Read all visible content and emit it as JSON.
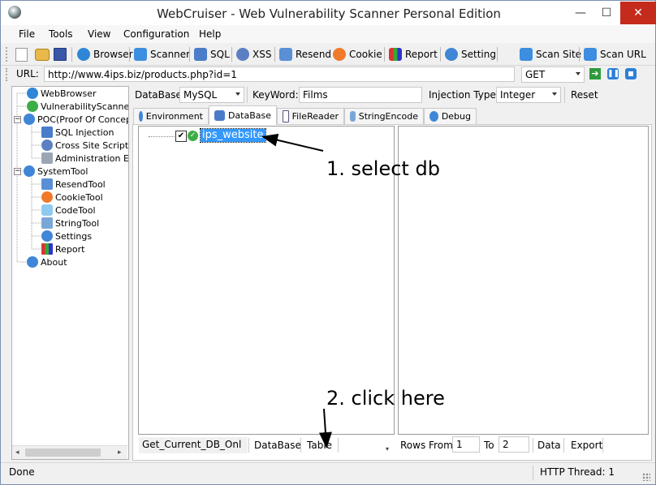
{
  "window": {
    "title": "WebCruiser - Web Vulnerability Scanner Personal Edition",
    "minimize": "—",
    "maximize": "☐",
    "close": "✕"
  },
  "menu": [
    "File",
    "Tools",
    "View",
    "Configuration",
    "Help"
  ],
  "toolbar": {
    "browser": "Browser",
    "scanner": "Scanner",
    "sql": "SQL",
    "xss": "XSS",
    "resend": "Resend",
    "cookie": "Cookie",
    "report": "Report",
    "setting": "Setting",
    "scan_site": "Scan Site",
    "scan_url": "Scan URL"
  },
  "urlbar": {
    "label": "URL:",
    "value": "http://www.4ips.biz/products.php?id=1",
    "method": "GET"
  },
  "tree": {
    "items": [
      "WebBrowser",
      "VulnerabilityScanner",
      "POC(Proof Of Concept)",
      "SQL Injection",
      "Cross Site Scripting",
      "Administration Entrance",
      "SystemTool",
      "ResendTool",
      "CookieTool",
      "CodeTool",
      "StringTool",
      "Settings",
      "Report",
      "About"
    ]
  },
  "filters": {
    "database_label": "DataBase:",
    "database_value": "MySQL",
    "keyword_label": "KeyWord:",
    "keyword_value": "Films",
    "injection_label": "Injection Type:",
    "injection_value": "Integer",
    "reset": "Reset"
  },
  "tabs": [
    "Environment",
    "DataBase",
    "FileReader",
    "StringEncode",
    "Debug"
  ],
  "db_tree": {
    "node": "ips_website"
  },
  "bottom": {
    "action_value": "Get_Current_DB_Onl",
    "database_btn": "DataBase",
    "table_btn": "Table",
    "rows_from_label": "Rows From",
    "rows_from": "1",
    "to_label": "To",
    "to": "2",
    "data_btn": "Data",
    "export_btn": "Export"
  },
  "annotations": {
    "step1": "1. select db",
    "step2": "2. click here"
  },
  "status": {
    "left": "Done",
    "thread": "HTTP Thread: 1"
  },
  "colors": {
    "accent": "#3399ff",
    "close_bg": "#c42b1c"
  }
}
